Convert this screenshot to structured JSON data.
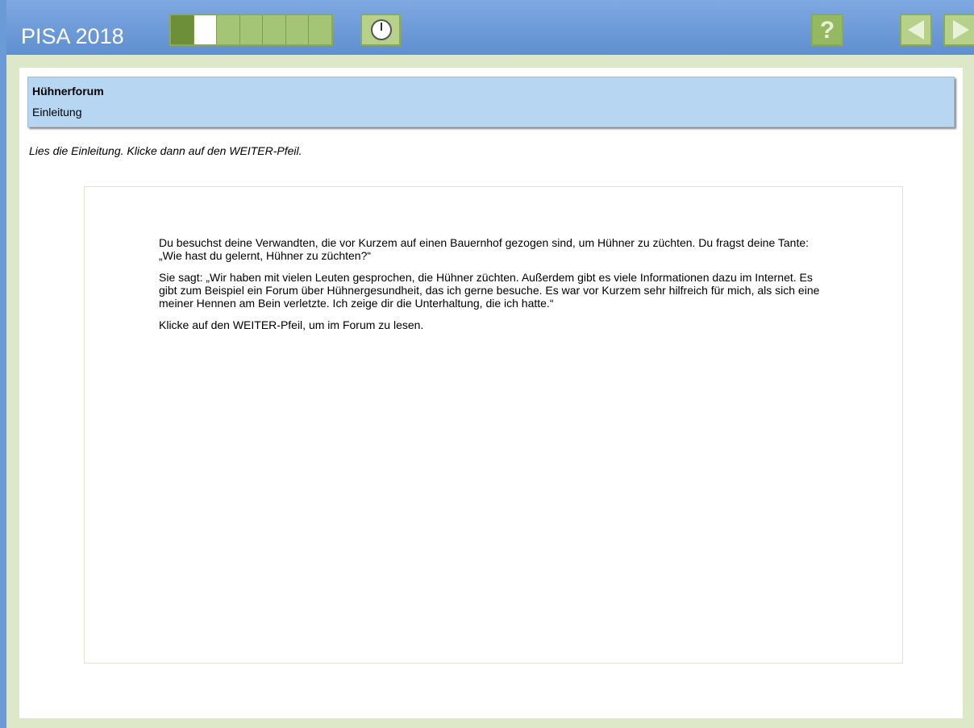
{
  "app": {
    "brand": "PISA 2018"
  },
  "progress": {
    "total_segments": 7,
    "completed_segments": 1,
    "current_segment": 2
  },
  "toolbar": {
    "help_label": "?",
    "help_icon": "question-icon",
    "back_icon": "triangle-left-icon",
    "forward_icon": "triangle-right-icon",
    "timer_icon": "clock-icon"
  },
  "unit": {
    "title": "Hühnerforum",
    "subtitle": "Einleitung"
  },
  "instruction": "Lies die Einleitung. Klicke dann auf den WEITER-Pfeil.",
  "stimulus": {
    "paragraphs": [
      "Du besuchst deine Verwandten, die vor Kurzem auf einen Bauernhof gezogen sind, um Hühner zu züchten. Du fragst deine Tante: „Wie hast du gelernt, Hühner zu züchten?“",
      "Sie sagt: „Wir haben mit vielen Leuten gesprochen, die Hühner züchten. Außerdem gibt es viele Informationen dazu im Internet. Es gibt zum Beispiel ein Forum über Hühnergesundheit, das ich gerne besuche. Es war vor Kurzem sehr hilfreich für mich, als sich eine meiner Hennen am Bein verletzte. Ich zeige dir die Unterhaltung, die ich hatte.“",
      "Klicke auf den WEITER-Pfeil, um im Forum zu lesen."
    ]
  },
  "colors": {
    "topbar": "#6b9bd6",
    "stage": "#dce8c8",
    "header_box": "#b6d6f2",
    "progress_done": "#6d8f3a",
    "progress_pending": "#a5c576"
  }
}
